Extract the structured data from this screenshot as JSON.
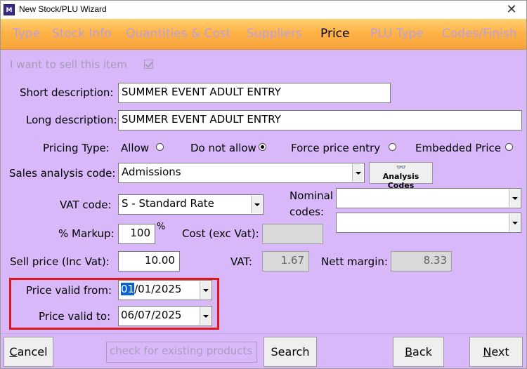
{
  "window": {
    "title": "New Stock/PLU Wizard",
    "icon_text": "M",
    "close_glyph": "✕"
  },
  "tabs": [
    {
      "label": "Type",
      "active": false
    },
    {
      "label": "Stock Info",
      "active": false
    },
    {
      "label": "Quantities & Cost",
      "active": false
    },
    {
      "label": "Suppliers",
      "active": false
    },
    {
      "label": "Price",
      "active": true
    },
    {
      "label": "PLU Type",
      "active": false
    },
    {
      "label": "Codes/Finish",
      "active": false
    }
  ],
  "form": {
    "sell_item_label": "I want to sell this item",
    "sell_item_checked": true,
    "short_description_label": "Short description:",
    "short_description_value": "SUMMER EVENT ADULT ENTRY",
    "long_description_label": "Long description:",
    "long_description_value": "SUMMER EVENT ADULT ENTRY",
    "pricing_type_label": "Pricing Type:",
    "pricing_options": [
      {
        "label": "Allow",
        "selected": false
      },
      {
        "label": "Do not allow",
        "selected": true
      },
      {
        "label": "Force price entry",
        "selected": false
      },
      {
        "label": "Embedded Price",
        "selected": false
      }
    ],
    "sales_analysis_label": "Sales analysis code:",
    "sales_analysis_value": "Admissions",
    "analysis_codes_button": "Analysis Codes",
    "vat_code_label": "VAT code:",
    "vat_code_value": "S - Standard Rate",
    "nominal_codes_label_1": "Nominal",
    "nominal_codes_label_2": "codes:",
    "nominal_code_1_value": "",
    "nominal_code_2_value": "",
    "markup_label": "% Markup:",
    "markup_value": "100",
    "markup_unit": "%",
    "cost_label": "Cost (exc Vat):",
    "cost_value": "",
    "sell_price_label": "Sell price (Inc Vat):",
    "sell_price_value": "10.00",
    "vat_label": "VAT:",
    "vat_value": "1.67",
    "nett_margin_label": "Nett margin:",
    "nett_margin_value": "8.33",
    "price_valid_from_label": "Price valid from:",
    "price_valid_from_selected": "01",
    "price_valid_from_rest": "/01/2025",
    "price_valid_to_label": "Price valid to:",
    "price_valid_to_value": "06/07/2025"
  },
  "footer": {
    "cancel_underline": "C",
    "cancel_rest": "ancel",
    "search_placeholder": "check for existing products",
    "search_button": "Search",
    "back_underline": "B",
    "back_rest": "ack",
    "next_underline": "N",
    "next_rest": "ext"
  },
  "colors": {
    "background": "#d8b8f8",
    "tabbar": "#ffb347",
    "tab_inactive": "#b8a0e0",
    "highlight": "#e0161e",
    "selection": "#0a64d0"
  }
}
